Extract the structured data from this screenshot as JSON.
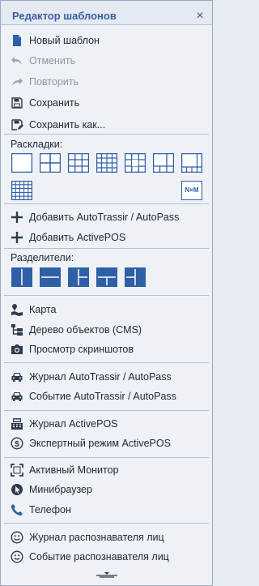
{
  "title": "Редактор шаблонов",
  "close_glyph": "×",
  "actions": [
    {
      "label": "Новый шаблон",
      "icon": "file-icon",
      "enabled": true
    },
    {
      "label": "Отменить",
      "icon": "undo-icon",
      "enabled": false
    },
    {
      "label": "Повторить",
      "icon": "redo-icon",
      "enabled": false
    },
    {
      "label": "Сохранить",
      "icon": "save-icon",
      "enabled": true
    },
    {
      "label": "Сохранить как...",
      "icon": "save-as-icon",
      "enabled": true
    }
  ],
  "layouts": {
    "label": "Раскладки:",
    "custom_label": "N×M"
  },
  "add_items": [
    {
      "label": "Добавить AutoTrassir / AutoPass",
      "icon": "plus-icon"
    },
    {
      "label": "Добавить ActivePOS",
      "icon": "plus-icon"
    }
  ],
  "dividers": {
    "label": "Разделители:"
  },
  "widgets": [
    {
      "label": "Карта",
      "icon": "map-icon"
    },
    {
      "label": "Дерево объектов (CMS)",
      "icon": "tree-icon"
    },
    {
      "label": "Просмотр скриншотов",
      "icon": "camera-icon"
    }
  ],
  "auto": [
    {
      "label": "Журнал AutoTrassir / AutoPass",
      "icon": "car-icon"
    },
    {
      "label": "Событие AutoTrassir / AutoPass",
      "icon": "car-icon"
    }
  ],
  "pos": [
    {
      "label": "Журнал ActivePOS",
      "icon": "pos-icon"
    },
    {
      "label": "Экспертный режим ActivePOS",
      "icon": "dollar-icon"
    }
  ],
  "misc": [
    {
      "label": "Активный Монитор",
      "icon": "fullscreen-icon"
    },
    {
      "label": "Минибраузер",
      "icon": "cursor-icon"
    },
    {
      "label": "Телефон",
      "icon": "phone-icon"
    }
  ],
  "faces": [
    {
      "label": "Журнал распознавателя лиц",
      "icon": "smile-icon"
    },
    {
      "label": "Событие распознавателя лиц",
      "icon": "smile-icon"
    }
  ],
  "colors": {
    "accent": "#2f5fa7",
    "text": "#1f2633",
    "disabled": "#8e96a3",
    "separator": "#b3bfd3"
  }
}
